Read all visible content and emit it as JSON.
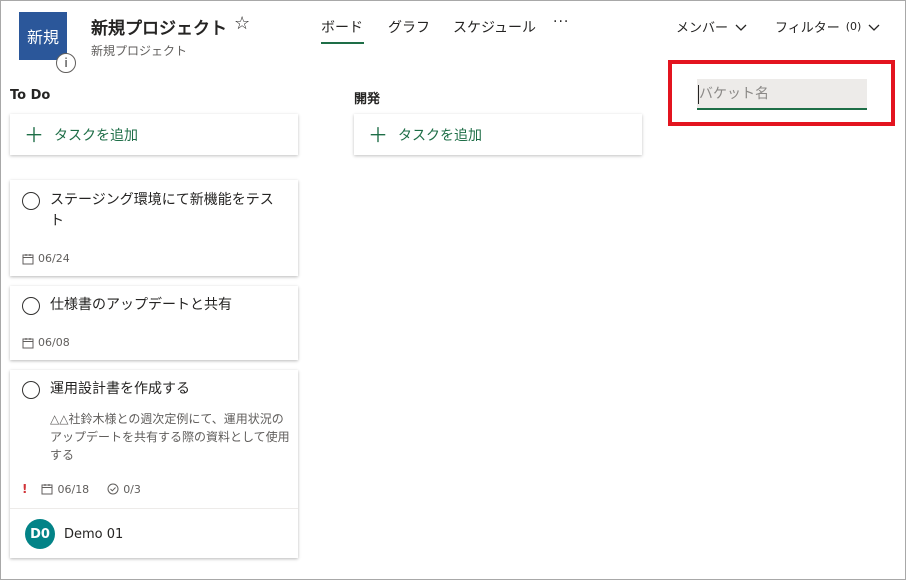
{
  "project": {
    "logo_text": "新規",
    "info_glyph": "i",
    "title": "新規プロジェクト",
    "star_glyph": "☆",
    "subtitle": "新規プロジェクト"
  },
  "tabs": [
    {
      "label": "ボード",
      "active": true
    },
    {
      "label": "グラフ",
      "active": false
    },
    {
      "label": "スケジュール",
      "active": false
    }
  ],
  "more_glyph": "···",
  "header_right": {
    "members_label": "メンバー",
    "filter_label": "フィルター",
    "filter_count": "(0)"
  },
  "buckets": [
    {
      "name": "To Do",
      "add_task_label": "タスクを追加"
    },
    {
      "name": "開発",
      "add_task_label": "タスクを追加"
    }
  ],
  "new_bucket": {
    "placeholder": "バケット名",
    "value": ""
  },
  "plus_glyph": "＋",
  "tasks": [
    {
      "title": "ステージング環境にて新機能をテスト",
      "due": "06/24"
    },
    {
      "title": "仕様書のアップデートと共有",
      "due": "06/08"
    },
    {
      "title": "運用設計書を作成する",
      "description": "△△社鈴木様との週次定例にて、運用状況のアップデートを共有する際の資料として使用する",
      "important_glyph": "!",
      "due": "06/18",
      "checklist": "0/3",
      "assignee_initials": "D0",
      "assignee_name": "Demo 01"
    }
  ],
  "colors": {
    "accent_green": "#1e6e47",
    "logo_blue": "#2b579a",
    "highlight_red": "#e3141f",
    "avatar_teal": "#038387"
  }
}
